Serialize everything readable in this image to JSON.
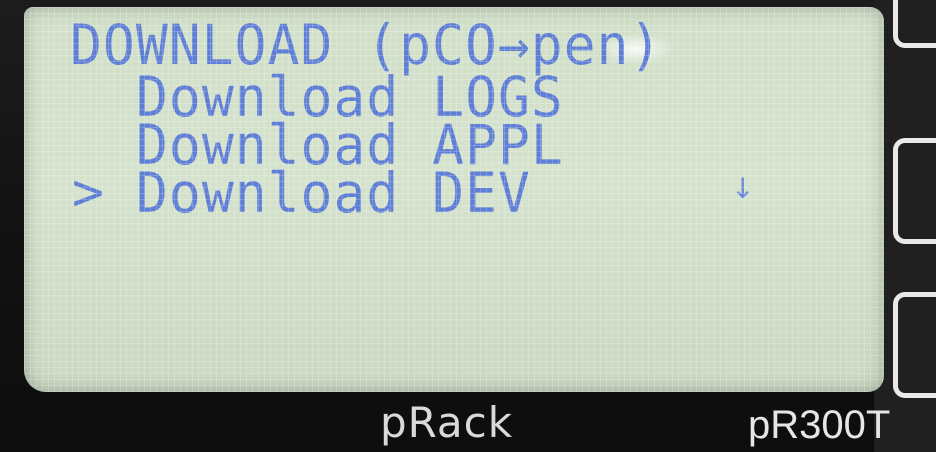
{
  "screen": {
    "title": "DOWNLOAD (pCO→pen)",
    "cursor_symbol": ">",
    "scroll_indicator": "↓",
    "menu_items": [
      {
        "label": "Download LOGS",
        "selected": false
      },
      {
        "label": "Download APPL",
        "selected": false
      },
      {
        "label": "Download DEV",
        "selected": true
      }
    ]
  },
  "device": {
    "brand": "pRack",
    "model": "pR300T"
  },
  "colors": {
    "lcd_background": "#d1dfc9",
    "lcd_text": "#5f7fd6",
    "bezel": "#161616",
    "label_text": "#e6e6e6"
  }
}
